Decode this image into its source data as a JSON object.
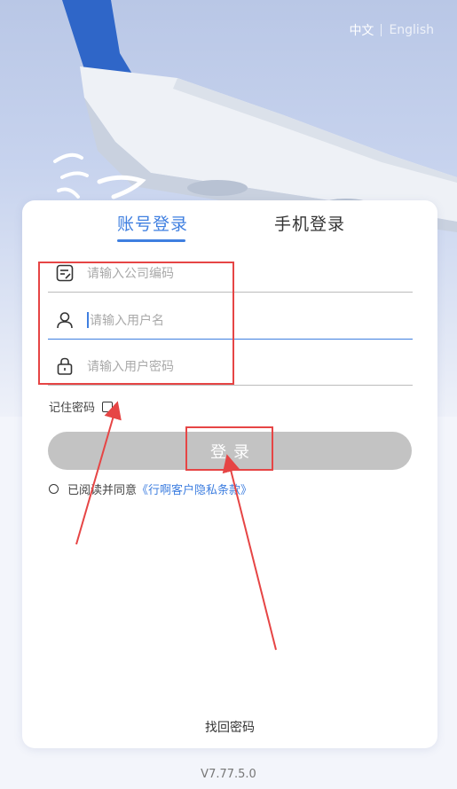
{
  "header": {
    "lang_zh": "中文",
    "lang_en": "English"
  },
  "tabs": [
    {
      "label": "账号登录",
      "active": true
    },
    {
      "label": "手机登录",
      "active": false
    }
  ],
  "fields": {
    "company_code": {
      "placeholder": "请输入公司编码"
    },
    "username": {
      "placeholder": "请输入用户名"
    },
    "password": {
      "placeholder": "请输入用户密码"
    }
  },
  "remember": {
    "label": "记住密码",
    "checked": false
  },
  "login": {
    "label": "登录"
  },
  "agreement": {
    "prefix": "已阅读并同意",
    "link": "《行啊客户隐私条款》",
    "checked": false
  },
  "forgot": {
    "label": "找回密码"
  },
  "version": "V7.77.5.0",
  "colors": {
    "accent": "#3f7fe0",
    "button_disabled": "#c3c3c3",
    "annotation": "#e64545"
  }
}
